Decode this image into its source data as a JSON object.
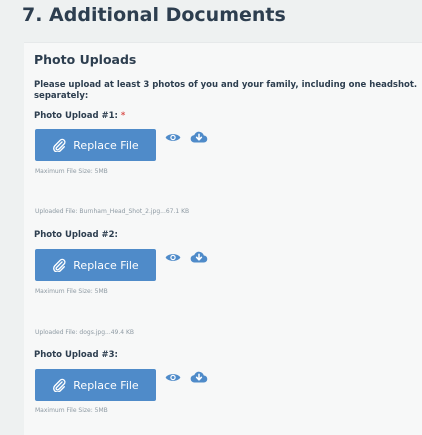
{
  "section": {
    "title": "7. Additional Documents"
  },
  "panel": {
    "title": "Photo Uploads",
    "instructions_line1": "Please upload at least 3 photos of you and your family, including one headshot.",
    "instructions_line2": "separately:"
  },
  "uploads": [
    {
      "label": "Photo Upload #1:",
      "required_mark": "*",
      "button_label": "Replace File",
      "max_size": "Maximum File Size: 5MB",
      "uploaded_file": "Uploaded File: Burnham_Head_Shot_2.jpg...67.1 KB"
    },
    {
      "label": "Photo Upload #2:",
      "button_label": "Replace File",
      "max_size": "Maximum File Size: 5MB",
      "uploaded_file": "Uploaded File: dogs.jpg...49.4 KB"
    },
    {
      "label": "Photo Upload #3:",
      "button_label": "Replace File",
      "max_size": "Maximum File Size: 5MB"
    }
  ],
  "icons": {
    "button_icon": "paperclip-icon",
    "view_icon": "eye-icon",
    "download_icon": "cloud-download-icon"
  },
  "colors": {
    "heading": "#2d3e4f",
    "button": "#4f8bc9",
    "required": "#d9534f",
    "muted_text": "#8e9aa3"
  }
}
